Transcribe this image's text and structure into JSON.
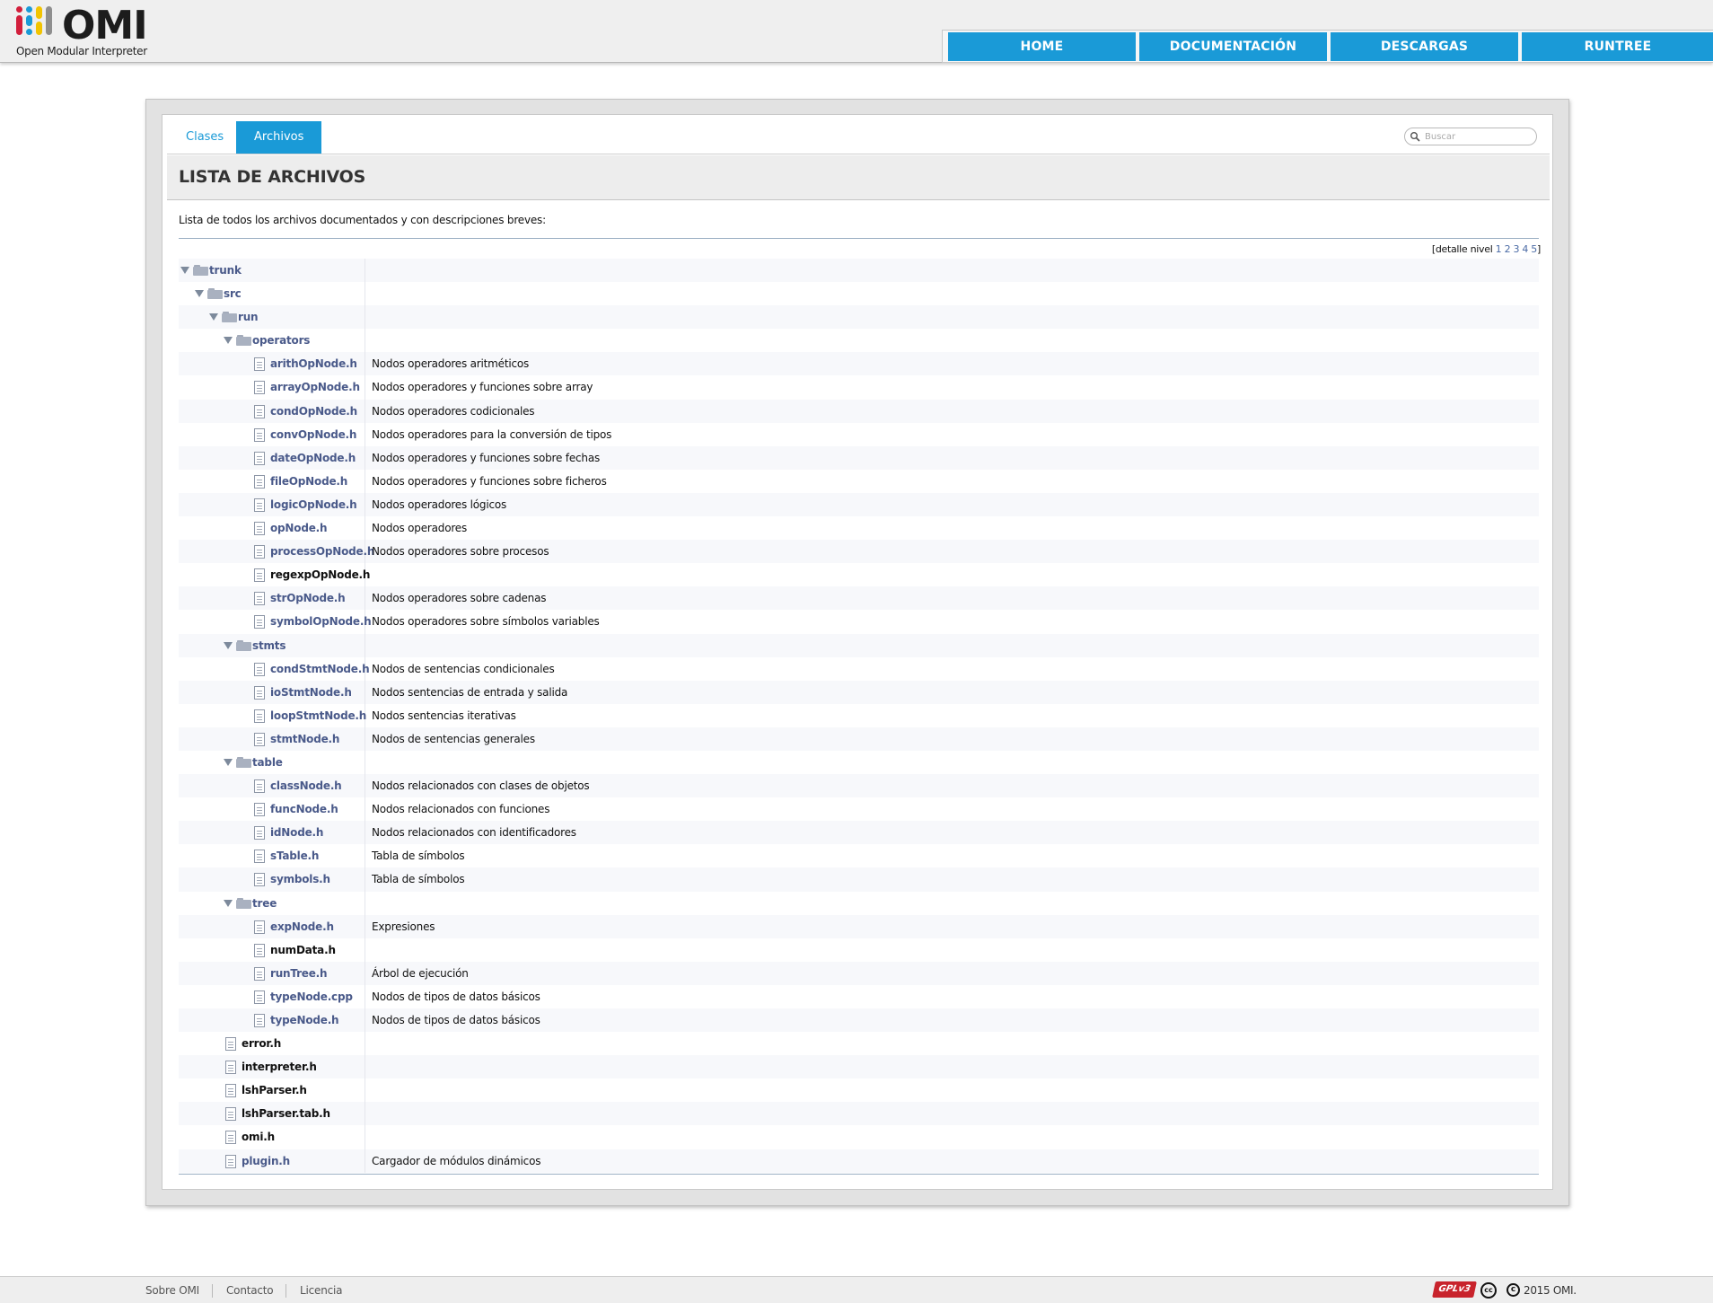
{
  "header": {
    "logo_text": "OMI",
    "logo_subtitle": "Open Modular Interpreter",
    "nav": [
      {
        "label": "HOME"
      },
      {
        "label": "DOCUMENTACIÓN"
      },
      {
        "label": "DESCARGAS"
      },
      {
        "label": "RUNTREE"
      }
    ],
    "colors": {
      "nav_bg": "#1a9ad7",
      "logo_bars": [
        "#d21f3c",
        "#1a9ad7",
        "#f2c400",
        "#8e8e8e"
      ]
    }
  },
  "tabs": [
    {
      "label": "Clases",
      "active": false
    },
    {
      "label": "Archivos",
      "active": true
    }
  ],
  "search": {
    "placeholder": "Buscar",
    "icon": "search-icon"
  },
  "page": {
    "title": "LISTA DE ARCHIVOS",
    "description": "Lista de todos los archivos documentados y con descripciones breves:",
    "levels_label": "detalle nivel",
    "levels": [
      "1",
      "2",
      "3",
      "4",
      "5"
    ]
  },
  "tree": [
    {
      "name": "trunk",
      "type": "folder",
      "depth": 0,
      "desc": "",
      "linked": true
    },
    {
      "name": "src",
      "type": "folder",
      "depth": 1,
      "desc": "",
      "linked": true
    },
    {
      "name": "run",
      "type": "folder",
      "depth": 2,
      "desc": "",
      "linked": true
    },
    {
      "name": "operators",
      "type": "folder",
      "depth": 3,
      "desc": "",
      "linked": true
    },
    {
      "name": "arithOpNode.h",
      "type": "file",
      "depth": 4,
      "desc": "Nodos operadores aritméticos",
      "linked": true
    },
    {
      "name": "arrayOpNode.h",
      "type": "file",
      "depth": 4,
      "desc": "Nodos operadores y funciones sobre array",
      "linked": true
    },
    {
      "name": "condOpNode.h",
      "type": "file",
      "depth": 4,
      "desc": "Nodos operadores codicionales",
      "linked": true
    },
    {
      "name": "convOpNode.h",
      "type": "file",
      "depth": 4,
      "desc": "Nodos operadores para la conversión de tipos",
      "linked": true
    },
    {
      "name": "dateOpNode.h",
      "type": "file",
      "depth": 4,
      "desc": "Nodos operadores y funciones sobre fechas",
      "linked": true
    },
    {
      "name": "fileOpNode.h",
      "type": "file",
      "depth": 4,
      "desc": "Nodos operadores y funciones sobre ficheros",
      "linked": true
    },
    {
      "name": "logicOpNode.h",
      "type": "file",
      "depth": 4,
      "desc": "Nodos operadores lógicos",
      "linked": true
    },
    {
      "name": "opNode.h",
      "type": "file",
      "depth": 4,
      "desc": "Nodos operadores",
      "linked": true
    },
    {
      "name": "processOpNode.h",
      "type": "file",
      "depth": 4,
      "desc": "Nodos operadores sobre procesos",
      "linked": true
    },
    {
      "name": "regexpOpNode.h",
      "type": "file",
      "depth": 4,
      "desc": "",
      "linked": false
    },
    {
      "name": "strOpNode.h",
      "type": "file",
      "depth": 4,
      "desc": "Nodos operadores sobre cadenas",
      "linked": true
    },
    {
      "name": "symbolOpNode.h",
      "type": "file",
      "depth": 4,
      "desc": "Nodos operadores sobre símbolos variables",
      "linked": true
    },
    {
      "name": "stmts",
      "type": "folder",
      "depth": 3,
      "desc": "",
      "linked": true
    },
    {
      "name": "condStmtNode.h",
      "type": "file",
      "depth": 4,
      "desc": "Nodos de sentencias condicionales",
      "linked": true
    },
    {
      "name": "ioStmtNode.h",
      "type": "file",
      "depth": 4,
      "desc": "Nodos sentencias de entrada y salida",
      "linked": true
    },
    {
      "name": "loopStmtNode.h",
      "type": "file",
      "depth": 4,
      "desc": "Nodos sentencias iterativas",
      "linked": true
    },
    {
      "name": "stmtNode.h",
      "type": "file",
      "depth": 4,
      "desc": "Nodos de sentencias generales",
      "linked": true
    },
    {
      "name": "table",
      "type": "folder",
      "depth": 3,
      "desc": "",
      "linked": true
    },
    {
      "name": "classNode.h",
      "type": "file",
      "depth": 4,
      "desc": "Nodos relacionados con clases de objetos",
      "linked": true
    },
    {
      "name": "funcNode.h",
      "type": "file",
      "depth": 4,
      "desc": "Nodos relacionados con funciones",
      "linked": true
    },
    {
      "name": "idNode.h",
      "type": "file",
      "depth": 4,
      "desc": "Nodos relacionados con identificadores",
      "linked": true
    },
    {
      "name": "sTable.h",
      "type": "file",
      "depth": 4,
      "desc": "Tabla de símbolos",
      "linked": true
    },
    {
      "name": "symbols.h",
      "type": "file",
      "depth": 4,
      "desc": "Tabla de símbolos",
      "linked": true
    },
    {
      "name": "tree",
      "type": "folder",
      "depth": 3,
      "desc": "",
      "linked": true
    },
    {
      "name": "expNode.h",
      "type": "file",
      "depth": 4,
      "desc": "Expresiones",
      "linked": true
    },
    {
      "name": "numData.h",
      "type": "file",
      "depth": 4,
      "desc": "",
      "linked": false
    },
    {
      "name": "runTree.h",
      "type": "file",
      "depth": 4,
      "desc": "Árbol de ejecución",
      "linked": true
    },
    {
      "name": "typeNode.cpp",
      "type": "file",
      "depth": 4,
      "desc": "Nodos de tipos de datos básicos",
      "linked": true
    },
    {
      "name": "typeNode.h",
      "type": "file",
      "depth": 4,
      "desc": "Nodos de tipos de datos básicos",
      "linked": true
    },
    {
      "name": "error.h",
      "type": "file",
      "depth": 2,
      "desc": "",
      "linked": false
    },
    {
      "name": "interpreter.h",
      "type": "file",
      "depth": 2,
      "desc": "",
      "linked": false
    },
    {
      "name": "lshParser.h",
      "type": "file",
      "depth": 2,
      "desc": "",
      "linked": false
    },
    {
      "name": "lshParser.tab.h",
      "type": "file",
      "depth": 2,
      "desc": "",
      "linked": false
    },
    {
      "name": "omi.h",
      "type": "file",
      "depth": 2,
      "desc": "",
      "linked": false
    },
    {
      "name": "plugin.h",
      "type": "file",
      "depth": 2,
      "desc": "Cargador de módulos dinámicos",
      "linked": true
    }
  ],
  "footer": {
    "links": [
      {
        "label": "Sobre OMI"
      },
      {
        "label": "Contacto"
      },
      {
        "label": "Licencia"
      }
    ],
    "gpl_badge": "GPLv3",
    "cc_badge": "cc",
    "copyright": "2015 OMI."
  }
}
